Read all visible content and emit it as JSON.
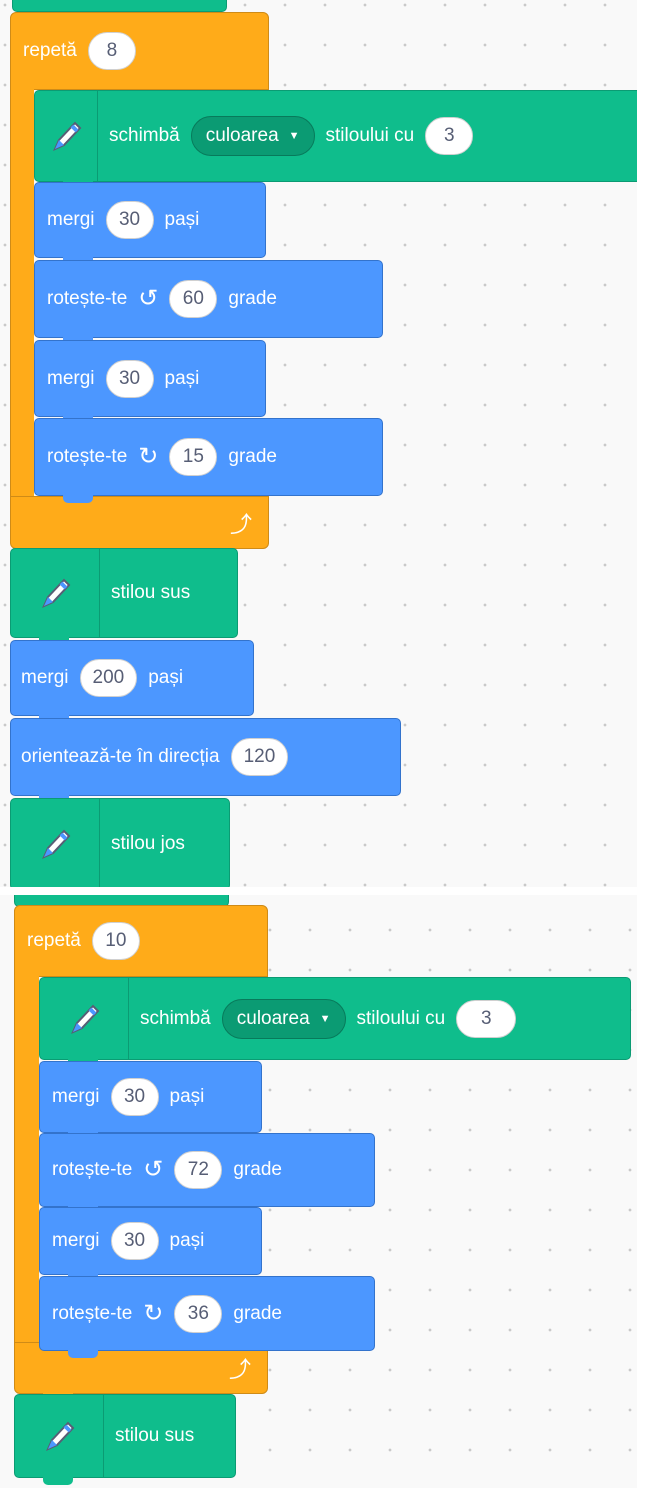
{
  "colors": {
    "motion": "#4c97ff",
    "pen": "#0fbd8c",
    "control": "#ffab19",
    "workspace": "#f9f9f9"
  },
  "icons": {
    "pen": "pen-icon",
    "turn_left": "rotate-left-icon",
    "turn_right": "rotate-right-icon",
    "loop_end": "loop-arrow-icon"
  },
  "script1": {
    "repeat": {
      "label": "repetă",
      "count": "8"
    },
    "set_pen": {
      "label": "schimbă",
      "param": "culoarea",
      "suffix": "stiloului cu",
      "value": "3"
    },
    "move1": {
      "label": "mergi",
      "value": "30",
      "unit": "pași"
    },
    "turn1": {
      "label": "rotește-te",
      "value": "60",
      "unit": "grade"
    },
    "move2": {
      "label": "mergi",
      "value": "30",
      "unit": "pași"
    },
    "turn2": {
      "label": "rotește-te",
      "value": "15",
      "unit": "grade"
    },
    "pen_up": {
      "label": "stilou sus"
    },
    "move3": {
      "label": "mergi",
      "value": "200",
      "unit": "pași"
    },
    "point": {
      "label": "orientează-te în direcția",
      "value": "120"
    },
    "pen_down": {
      "label": "stilou jos"
    }
  },
  "script2": {
    "repeat": {
      "label": "repetă",
      "count": "10"
    },
    "set_pen": {
      "label": "schimbă",
      "param": "culoarea",
      "suffix": "stiloului cu",
      "value": "3"
    },
    "move1": {
      "label": "mergi",
      "value": "30",
      "unit": "pași"
    },
    "turn1": {
      "label": "rotește-te",
      "value": "72",
      "unit": "grade"
    },
    "move2": {
      "label": "mergi",
      "value": "30",
      "unit": "pași"
    },
    "turn2": {
      "label": "rotește-te",
      "value": "36",
      "unit": "grade"
    },
    "pen_up": {
      "label": "stilou sus"
    }
  }
}
